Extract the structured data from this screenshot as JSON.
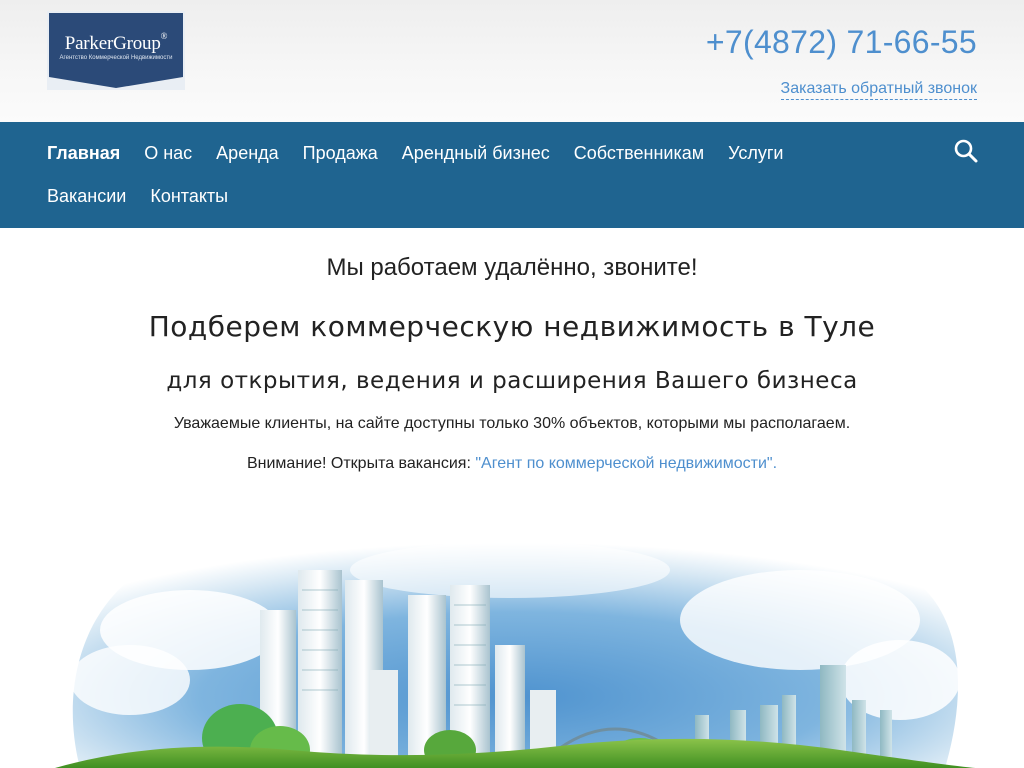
{
  "header": {
    "logo": {
      "name": "ParkerGroup",
      "registered": "®",
      "tagline": "Агентство Коммерческой Недвижимости"
    },
    "phone": "+7(4872) 71-66-55",
    "callback_label": "Заказать обратный звонок"
  },
  "nav": {
    "items": [
      {
        "label": "Главная",
        "active": true
      },
      {
        "label": "О нас"
      },
      {
        "label": "Аренда"
      },
      {
        "label": "Продажа"
      },
      {
        "label": "Арендный бизнес"
      },
      {
        "label": "Собственникам"
      },
      {
        "label": "Услуги"
      },
      {
        "label": "Вакансии"
      },
      {
        "label": "Контакты"
      }
    ],
    "search_icon": "search-icon"
  },
  "main": {
    "remote_notice": "Мы работаем удалённо, звоните!",
    "headline": "Подберем коммерческую недвижимость в Туле",
    "subheadline": "для открытия, ведения и расширения Вашего бизнеса",
    "availability_notice": "Уважаемые клиенты, на сайте доступны только 30% объектов, которыми мы располагаем.",
    "vacancy_prefix": "Внимание! Открыта вакансия: ",
    "vacancy_link": "\"Агент по коммерческой недвижимости\"."
  },
  "colors": {
    "nav_bg": "#1f6490",
    "accent": "#4e8fce",
    "logo_bg": "#2b4a78"
  }
}
